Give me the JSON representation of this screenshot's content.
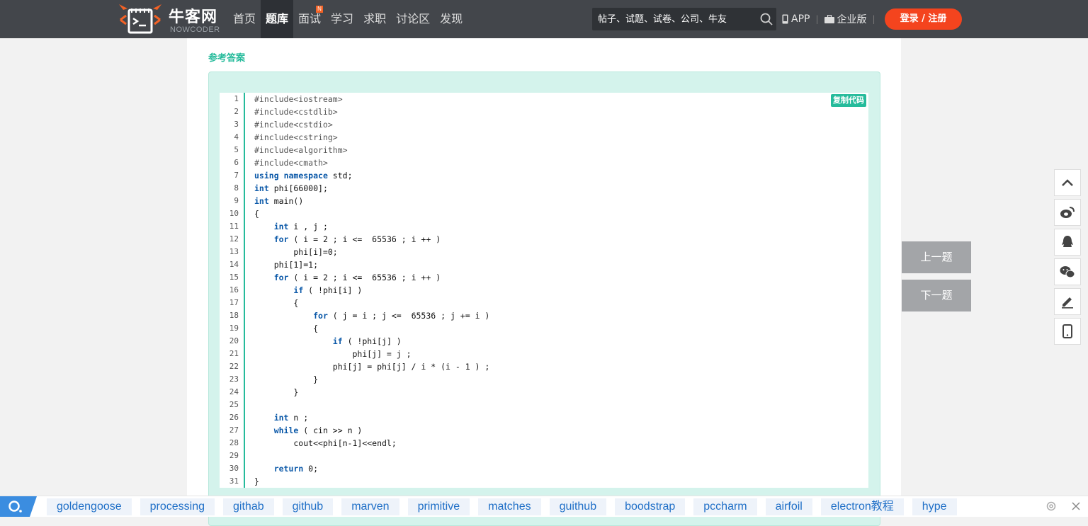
{
  "header": {
    "logo_cn": "牛客网",
    "logo_en": "NOWCODER",
    "nav": [
      {
        "label": "首页",
        "active": false
      },
      {
        "label": "题库",
        "active": true
      },
      {
        "label": "面试",
        "active": false,
        "badge": "N"
      },
      {
        "label": "学习",
        "active": false
      },
      {
        "label": "求职",
        "active": false
      },
      {
        "label": "讨论区",
        "active": false
      },
      {
        "label": "发现",
        "active": false
      }
    ],
    "search_placeholder": "帖子、试题、试卷、公司、牛友",
    "app_label": "APP",
    "enterprise_label": "企业版",
    "login_label": "登录 / 注册"
  },
  "answer": {
    "title": "参考答案",
    "copy_label": "复制代码",
    "lines": [
      "#include<iostream>",
      "#include<cstdlib>",
      "#include<cstdio>",
      "#include<cstring>",
      "#include<algorithm>",
      "#include<cmath>",
      "using namespace std;",
      "int phi[66000];",
      "int main()",
      "{",
      "    int i , j ;",
      "    for ( i = 2 ; i <=  65536 ; i ++ )",
      "        phi[i]=0;",
      "    phi[1]=1;",
      "    for ( i = 2 ; i <=  65536 ; i ++ )",
      "        if ( !phi[i] )",
      "        {",
      "            for ( j = i ; j <=  65536 ; j += i )",
      "            {",
      "                if ( !phi[j] )",
      "                    phi[j] = j ;",
      "                phi[j] = phi[j] / i * (i - 1 ) ;",
      "            }",
      "        }",
      "",
      "    int n ;",
      "    while ( cin >> n )",
      "        cout<<phi[n-1]<<endl;",
      "",
      "    return 0;",
      "}"
    ]
  },
  "pager": {
    "prev": "上一题",
    "next": "下一题"
  },
  "tools": [
    "arrow-up-icon",
    "weibo-icon",
    "qq-icon",
    "wechat-icon",
    "pencil-icon",
    "mobile-icon"
  ],
  "bottom_tags": [
    "goldengoose",
    "processing",
    "githab",
    "github",
    "marven",
    "primitive",
    "matches",
    "guithub",
    "boodstrap",
    "pccharm",
    "airfoil",
    "electron教程",
    "hype"
  ],
  "colors": {
    "accent": "#25bb9b",
    "topbar": "#43464b",
    "login": "#f4441e",
    "tag_text": "#1f6fc7"
  }
}
